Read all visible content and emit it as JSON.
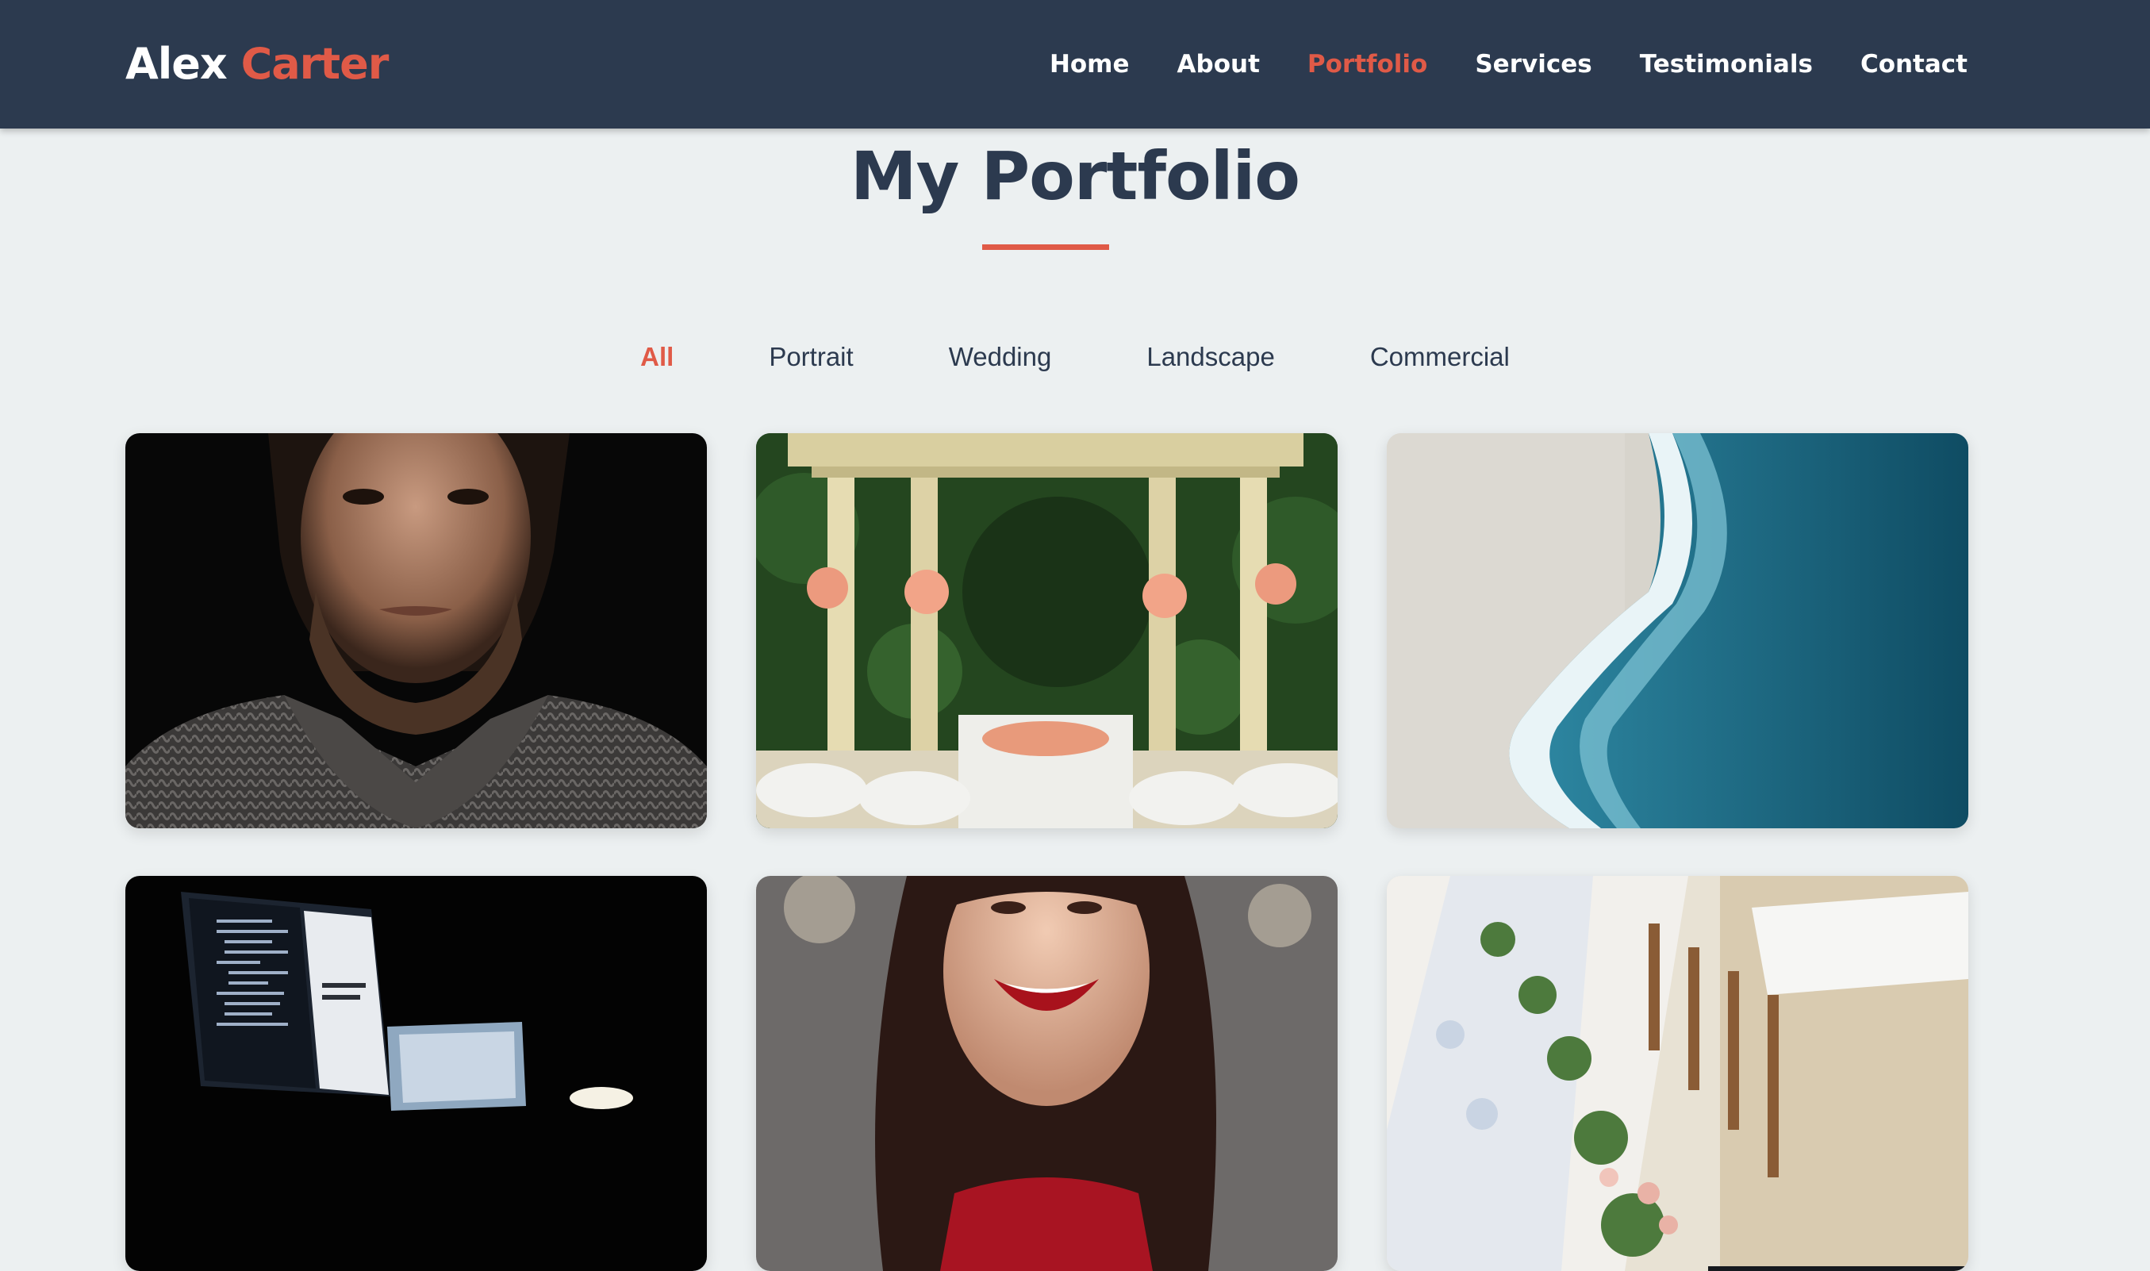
{
  "brand": {
    "first": "Alex",
    "last": "Carter"
  },
  "nav": {
    "items": [
      "Home",
      "About",
      "Portfolio",
      "Services",
      "Testimonials",
      "Contact"
    ],
    "active": "Portfolio"
  },
  "portfolio": {
    "title": "My Portfolio",
    "filters": [
      "All",
      "Portrait",
      "Wedding",
      "Landscape",
      "Commercial"
    ],
    "active_filter": "All",
    "items": [
      {
        "category": "Portrait",
        "image": "man-portrait-photo"
      },
      {
        "category": "Wedding",
        "image": "wedding-gazebo-photo"
      },
      {
        "category": "Landscape",
        "image": "aerial-beach-photo"
      },
      {
        "category": "Commercial",
        "image": "computer-workstation-photo"
      },
      {
        "category": "Portrait",
        "image": "smiling-woman-photo"
      },
      {
        "category": "Wedding",
        "image": "wedding-reception-table-photo"
      }
    ]
  },
  "colors": {
    "navbar": "#2c3a4f",
    "accent": "#e05a47",
    "background": "#ecf0f1",
    "heading": "#2c3a4f"
  }
}
